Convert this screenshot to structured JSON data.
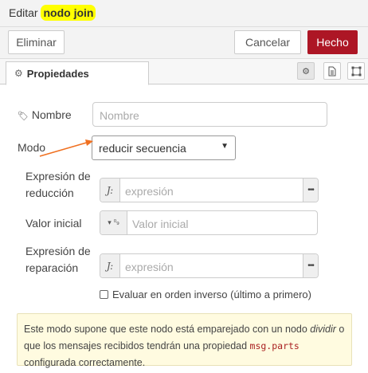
{
  "header": {
    "title_prefix": "Editar",
    "title_node": "nodo join"
  },
  "toolbar": {
    "delete_label": "Eliminar",
    "cancel_label": "Cancelar",
    "done_label": "Hecho"
  },
  "tabs": {
    "properties_label": "Propiedades"
  },
  "form": {
    "name_label": "Nombre",
    "name_placeholder": "Nombre",
    "mode_label": "Modo",
    "mode_value": "reducir secuencia",
    "reduce_label": "Expresión de reducción",
    "reduce_placeholder": "expresión",
    "initial_label": "Valor inicial",
    "initial_placeholder": "Valor inicial",
    "fixup_label": "Expresión de reparación",
    "fixup_placeholder": "expresión",
    "reverse_label": "Evaluar en orden inverso (último a primero)",
    "reverse_checked": false
  },
  "tip": {
    "text_1": "Este modo supone que este nodo está emparejado con un nodo ",
    "text_em": "dividir",
    "text_2": " o que los mensajes recibidos tendrán una propiedad ",
    "text_code": "msg.parts",
    "text_3": " configurada correctamente."
  },
  "colors": {
    "highlight": "#ffff00",
    "primary_button": "#ad1625",
    "annotation_arrow": "#f07020",
    "tip_background": "#fffbe0"
  }
}
